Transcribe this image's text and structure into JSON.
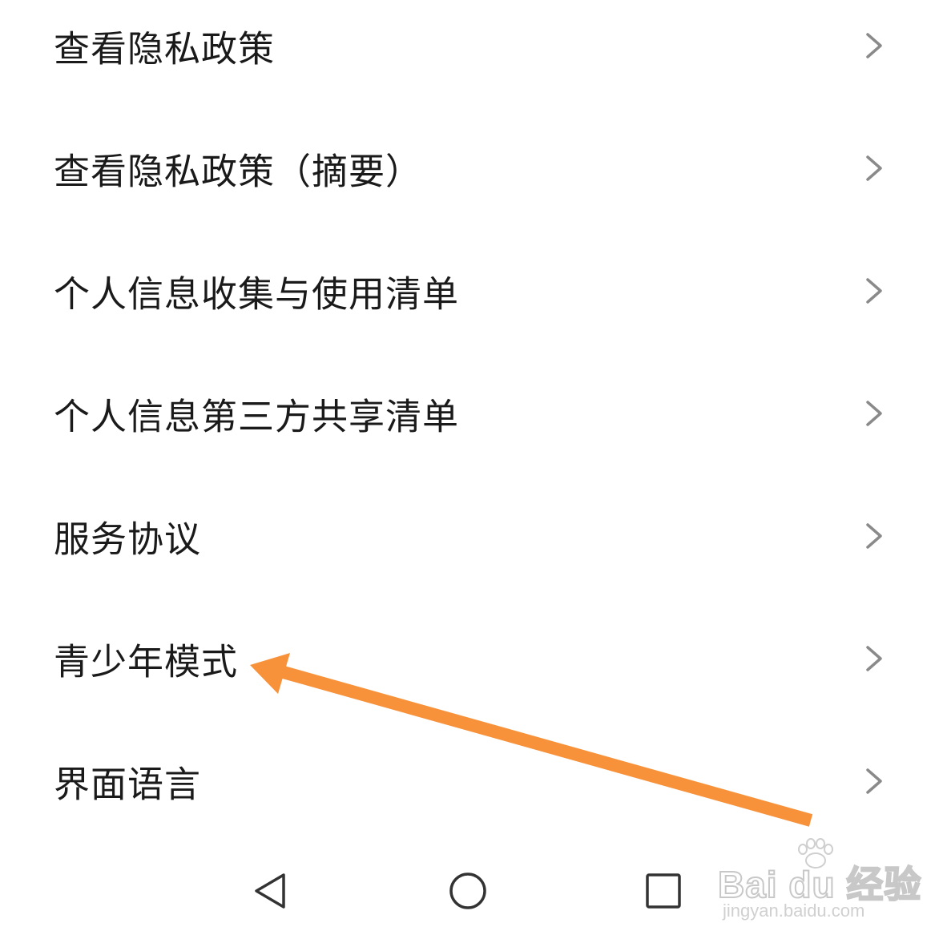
{
  "menu": {
    "items": [
      {
        "label": "查看隐私政策",
        "icon": "chevron-right-icon"
      },
      {
        "label": "查看隐私政策（摘要）",
        "icon": "chevron-right-icon"
      },
      {
        "label": "个人信息收集与使用清单",
        "icon": "chevron-right-icon"
      },
      {
        "label": "个人信息第三方共享清单",
        "icon": "chevron-right-icon"
      },
      {
        "label": "服务协议",
        "icon": "chevron-right-icon"
      },
      {
        "label": "青少年模式",
        "icon": "chevron-right-icon"
      },
      {
        "label": "界面语言",
        "icon": "chevron-right-icon"
      }
    ]
  },
  "annotation": {
    "type": "arrow",
    "color": "#F7923A",
    "points_to": "青少年模式"
  },
  "navbar": {
    "back_icon": "triangle-back-icon",
    "home_icon": "circle-home-icon",
    "recents_icon": "square-recents-icon"
  },
  "watermark": {
    "logo": "Bai du 经验",
    "url": "jingyan.baidu.com"
  },
  "colors": {
    "text": "#1a1a1a",
    "chevron": "#8a8a8a",
    "background": "#ffffff",
    "arrow": "#F7923A"
  }
}
